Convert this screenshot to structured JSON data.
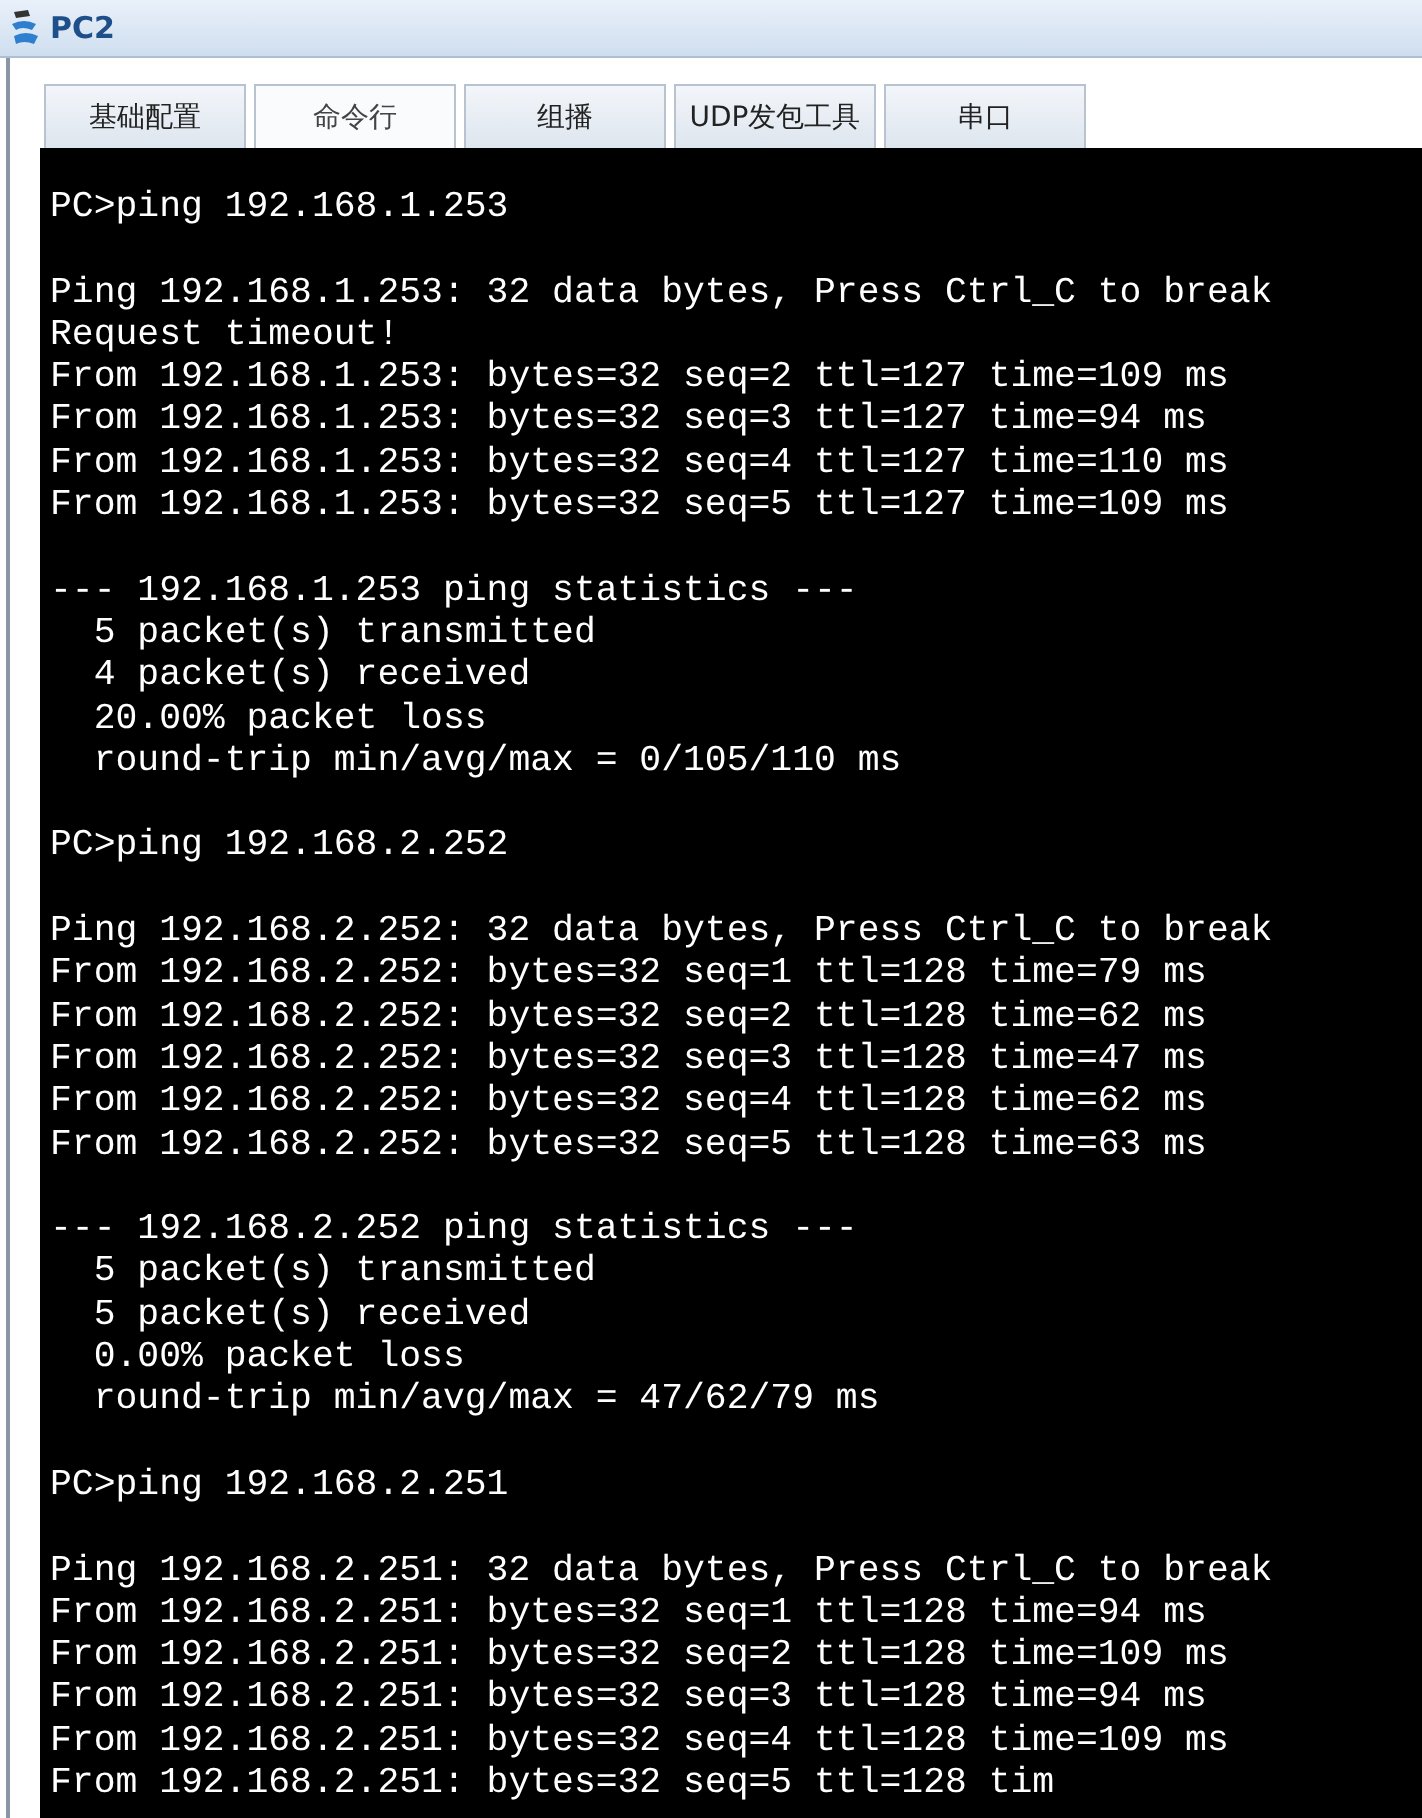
{
  "window": {
    "title": "PC2"
  },
  "tabs": [
    {
      "label": "基础配置",
      "selected": false
    },
    {
      "label": "命令行",
      "selected": true
    },
    {
      "label": "组播",
      "selected": false
    },
    {
      "label": "UDP发包工具",
      "selected": false
    },
    {
      "label": "串口",
      "selected": false
    }
  ],
  "terminal": {
    "blocks": [
      [
        "PC>ping 192.168.1.253"
      ],
      [
        "Ping 192.168.1.253: 32 data bytes, Press Ctrl_C to break",
        "Request timeout!",
        "From 192.168.1.253: bytes=32 seq=2 ttl=127 time=109 ms",
        "From 192.168.1.253: bytes=32 seq=3 ttl=127 time=94 ms",
        "From 192.168.1.253: bytes=32 seq=4 ttl=127 time=110 ms",
        "From 192.168.1.253: bytes=32 seq=5 ttl=127 time=109 ms"
      ],
      [
        "--- 192.168.1.253 ping statistics ---",
        "  5 packet(s) transmitted",
        "  4 packet(s) received",
        "  20.00% packet loss",
        "  round-trip min/avg/max = 0/105/110 ms"
      ],
      [
        "PC>ping 192.168.2.252"
      ],
      [
        "Ping 192.168.2.252: 32 data bytes, Press Ctrl_C to break",
        "From 192.168.2.252: bytes=32 seq=1 ttl=128 time=79 ms",
        "From 192.168.2.252: bytes=32 seq=2 ttl=128 time=62 ms",
        "From 192.168.2.252: bytes=32 seq=3 ttl=128 time=47 ms",
        "From 192.168.2.252: bytes=32 seq=4 ttl=128 time=62 ms",
        "From 192.168.2.252: bytes=32 seq=5 ttl=128 time=63 ms"
      ],
      [
        "--- 192.168.2.252 ping statistics ---",
        "  5 packet(s) transmitted",
        "  5 packet(s) received",
        "  0.00% packet loss",
        "  round-trip min/avg/max = 47/62/79 ms"
      ],
      [
        "PC>ping 192.168.2.251"
      ],
      [
        "Ping 192.168.2.251: 32 data bytes, Press Ctrl_C to break",
        "From 192.168.2.251: bytes=32 seq=1 ttl=128 time=94 ms",
        "From 192.168.2.251: bytes=32 seq=2 ttl=128 time=109 ms",
        "From 192.168.2.251: bytes=32 seq=3 ttl=128 time=94 ms",
        "From 192.168.2.251: bytes=32 seq=4 ttl=128 time=109 ms",
        "From 192.168.2.251: bytes=32 seq=5 ttl=128 tim"
      ]
    ]
  }
}
